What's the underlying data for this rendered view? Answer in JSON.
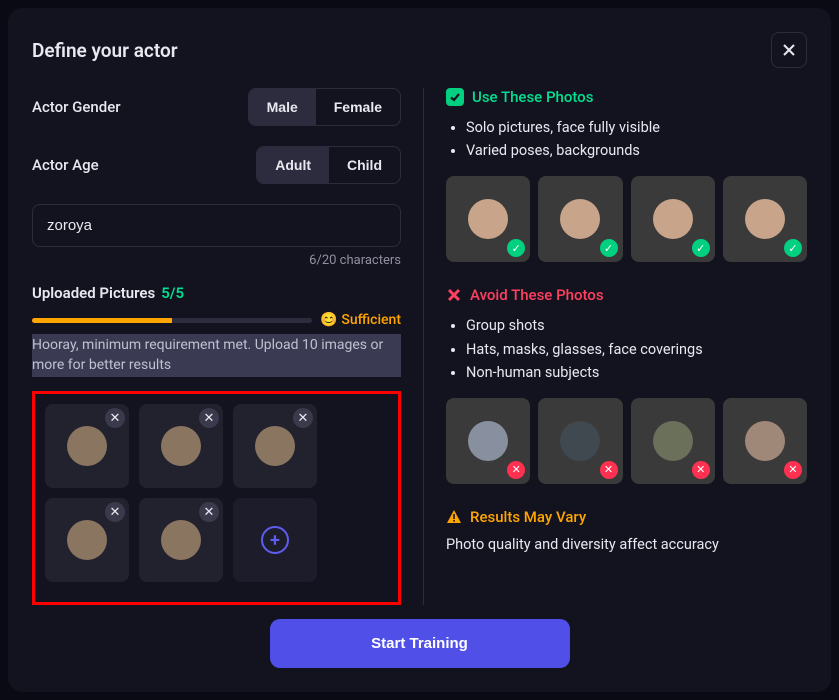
{
  "modal": {
    "title": "Define your actor"
  },
  "gender": {
    "label": "Actor Gender",
    "options": [
      "Male",
      "Female"
    ],
    "selected": "Male"
  },
  "age": {
    "label": "Actor Age",
    "options": [
      "Adult",
      "Child"
    ],
    "selected": "Adult"
  },
  "name": {
    "value": "zoroya",
    "char_count": "6/20 characters"
  },
  "uploaded": {
    "label": "Uploaded Pictures",
    "count": "5/5",
    "status": "Sufficient",
    "status_emoji": "😊",
    "progress_pct": 50,
    "hint": "Hooray, minimum requirement met. Upload 10 images or more for better results"
  },
  "guidelines": {
    "use": {
      "title": "Use These Photos",
      "bullets": [
        "Solo pictures, face fully visible",
        "Varied poses, backgrounds"
      ]
    },
    "avoid": {
      "title": "Avoid These Photos",
      "bullets": [
        "Group shots",
        "Hats, masks, glasses, face coverings",
        "Non-human subjects"
      ]
    },
    "vary": {
      "title": "Results May Vary",
      "text": "Photo quality and diversity affect accuracy"
    }
  },
  "cta": {
    "label": "Start Training"
  },
  "icons": {
    "check_badge": "✓",
    "x_badge": "✕",
    "remove": "✕",
    "plus": "+"
  }
}
